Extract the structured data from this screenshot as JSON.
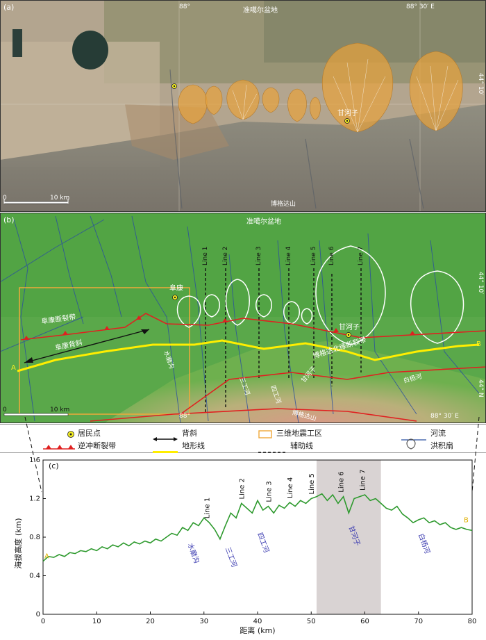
{
  "panel_a": {
    "label": "(a)",
    "top_center_label": "准噶尔盆地",
    "lon_label_left": "88°",
    "lon_label_right": "88° 30′ E",
    "lat_label": "44° 10′",
    "town_label": "甘河子",
    "bottom_label": "博格达山",
    "scale_zero": "0",
    "scale_ten": "10 km",
    "colors": {
      "fan_fill": "#e8a23c",
      "desert": "#b7a991",
      "farmland": "#7d8a5c",
      "mountain": "#8d8579"
    }
  },
  "panel_b": {
    "label": "(b)",
    "top_label": "准噶尔盆地",
    "lon_label_left": "88°",
    "lon_label_right": "88° 30′ E",
    "lat_label_top": "44° 10′",
    "lat_label_bottom": "44° N",
    "fault_label_west": "阜康断裂带",
    "anticline_label": "阜康背斜",
    "town_fukang": "阜康",
    "town_ganhezi": "甘河子",
    "fault_label_east": "博格达北缘断裂带",
    "river_baiyang": "白杨河",
    "river_shuimo": "水磨沟",
    "river_sangong": "三工河",
    "river_sigong": "四工河",
    "river_ganhezi": "甘河子",
    "mountain_label": "博格达山",
    "point_a": "A",
    "point_b": "B",
    "lines": [
      "Line 1",
      "Line 2",
      "Line 3",
      "Line 4",
      "Line 5",
      "Line 6",
      "Line 7"
    ],
    "scale_zero": "0",
    "scale_ten": "10 km",
    "colors": {
      "green": "#5aa84a",
      "thrust": "#e02020",
      "profile": "#ffee00",
      "river": "#2a4fa0",
      "survey_box": "#f0a93a"
    }
  },
  "legend": {
    "items": [
      {
        "label": "居民点",
        "icon": "settlement-icon"
      },
      {
        "label": "背斜",
        "icon": "anticline-icon"
      },
      {
        "label": "三维地震工区",
        "icon": "survey-area-icon"
      },
      {
        "label": "河流",
        "icon": "river-icon"
      },
      {
        "label": "逆冲断裂带",
        "icon": "thrust-fault-icon"
      },
      {
        "label": "地形线",
        "icon": "profile-line-icon"
      },
      {
        "label": "辅助线",
        "icon": "auxiliary-line-icon"
      },
      {
        "label": "洪积扇",
        "icon": "alluvial-fan-icon"
      }
    ]
  },
  "panel_c": {
    "label": "(c)",
    "point_a": "A",
    "point_b": "B",
    "line_labels": [
      {
        "label": "Line 1",
        "x": 31
      },
      {
        "label": "Line 2",
        "x": 37.5
      },
      {
        "label": "Line 3",
        "x": 42.5
      },
      {
        "label": "Line 4",
        "x": 46.5
      },
      {
        "label": "Line 5",
        "x": 50.5
      },
      {
        "label": "Line 6",
        "x": 56
      },
      {
        "label": "Line 7",
        "x": 60
      }
    ],
    "rivers": [
      {
        "label": "水磨沟",
        "x": 27,
        "y": 0.77
      },
      {
        "label": "三工河",
        "x": 34,
        "y": 0.73
      },
      {
        "label": "四工河",
        "x": 40,
        "y": 0.88
      },
      {
        "label": "甘河子",
        "x": 57,
        "y": 0.95
      },
      {
        "label": "白杨河",
        "x": 70,
        "y": 0.87
      }
    ]
  },
  "chart_data": {
    "type": "line",
    "xlabel": "距离 (km)",
    "ylabel": "海拔高度 (km)",
    "xlim": [
      0,
      80
    ],
    "ylim": [
      0,
      1.6
    ],
    "xticks": [
      0,
      10,
      20,
      30,
      40,
      50,
      60,
      70,
      80
    ],
    "yticks": [
      0,
      0.4,
      0.8,
      1.2,
      1.6
    ],
    "highlight_range": [
      51,
      63
    ],
    "highlight_color": "#d9d3d3",
    "line_color": "#2e9a2e",
    "series": [
      {
        "x": [
          0,
          1,
          2,
          3,
          4,
          5,
          6,
          7,
          8,
          9,
          10,
          11,
          12,
          13,
          14,
          15,
          16,
          17,
          18,
          19,
          20,
          21,
          22,
          23,
          24,
          25,
          26,
          27,
          28,
          29,
          30,
          31,
          32,
          33,
          34,
          35,
          36,
          37,
          38,
          39,
          40,
          41,
          42,
          43,
          44,
          45,
          46,
          47,
          48,
          49,
          50,
          51,
          52,
          53,
          54,
          55,
          56,
          57,
          58,
          59,
          60,
          61,
          62,
          63,
          64,
          65,
          66,
          67,
          68,
          69,
          70,
          71,
          72,
          73,
          74,
          75,
          76,
          77,
          78,
          79,
          80
        ],
        "y": [
          0.55,
          0.6,
          0.59,
          0.62,
          0.6,
          0.64,
          0.63,
          0.66,
          0.65,
          0.68,
          0.66,
          0.7,
          0.68,
          0.72,
          0.7,
          0.74,
          0.71,
          0.75,
          0.73,
          0.76,
          0.74,
          0.78,
          0.76,
          0.8,
          0.84,
          0.82,
          0.9,
          0.87,
          0.95,
          0.92,
          1.0,
          0.95,
          0.88,
          0.78,
          0.92,
          1.05,
          1.0,
          1.15,
          1.1,
          1.05,
          1.18,
          1.08,
          1.12,
          1.05,
          1.13,
          1.1,
          1.16,
          1.12,
          1.18,
          1.15,
          1.2,
          1.22,
          1.25,
          1.18,
          1.24,
          1.15,
          1.22,
          1.05,
          1.2,
          1.22,
          1.24,
          1.18,
          1.2,
          1.15,
          1.1,
          1.08,
          1.12,
          1.04,
          1.0,
          0.95,
          0.98,
          1.0,
          0.95,
          0.97,
          0.93,
          0.95,
          0.9,
          0.88,
          0.9,
          0.88,
          0.87
        ]
      }
    ]
  }
}
